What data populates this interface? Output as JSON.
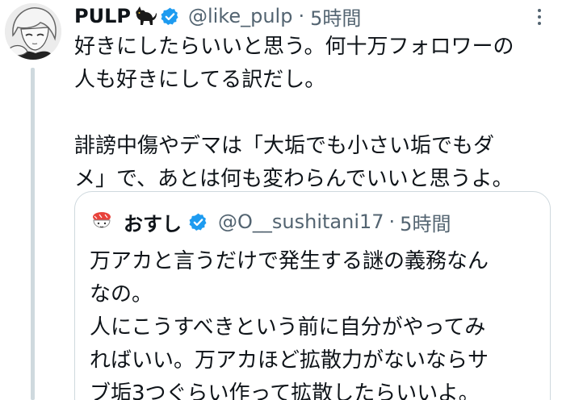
{
  "tweet": {
    "display_name": "PULP",
    "name_emoji": "black-cat-emoji",
    "handle": "@like_pulp",
    "separator": "·",
    "time": "5時間",
    "body_lines": [
      "好きにしたらいいと思う。何十万フォロワーの",
      "人も好きにしてる訳だし。",
      "",
      "誹謗中傷やデマは「大垢でも小さい垢でもダ",
      "メ」で、あとは何も変わらんでいいと思うよ。"
    ]
  },
  "quoted": {
    "display_name": "おすし",
    "handle": "@O__sushitani17",
    "separator": "·",
    "time": "5時間",
    "body_lines": [
      "万アカと言うだけで発生する謎の義務なん",
      "なの。",
      "人にこうすべきという前に自分がやってみ",
      "ればいい。万アカほど拡散力がないならサ",
      "ブ垢3つぐらい作って拡散したらいいよ。"
    ]
  },
  "colors": {
    "text": "#0f1419",
    "secondary": "#536471",
    "verified": "#1d9bf0",
    "border": "#cfd9de"
  },
  "icons": [
    "more-icon",
    "verified-badge-icon",
    "black-cat-emoji"
  ]
}
